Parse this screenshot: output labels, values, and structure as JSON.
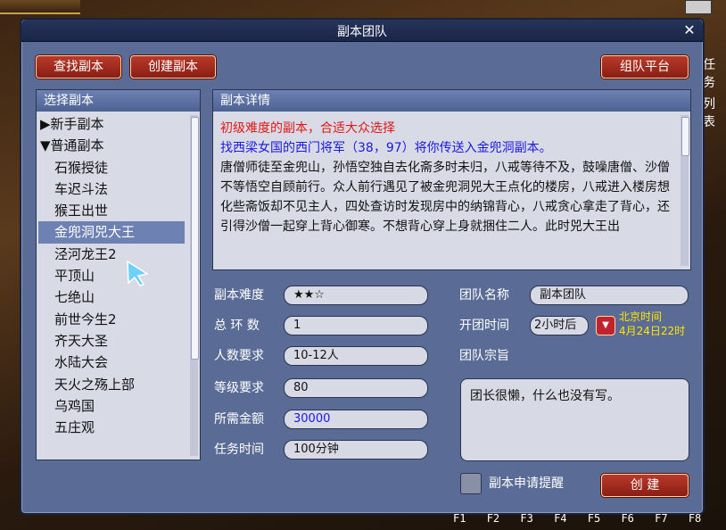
{
  "window": {
    "title": "副本团队"
  },
  "toolbar": {
    "find": "查找副本",
    "create": "创建副本",
    "platform": "组队平台"
  },
  "list": {
    "header": "选择副本",
    "items": [
      {
        "label": "▶新手副本"
      },
      {
        "label": "▼普通副本"
      },
      {
        "label": "石猴授徒"
      },
      {
        "label": "车迟斗法"
      },
      {
        "label": "猴王出世"
      },
      {
        "label": "金兜洞兕大王"
      },
      {
        "label": "泾河龙王2"
      },
      {
        "label": "平顶山"
      },
      {
        "label": "七绝山"
      },
      {
        "label": "前世今生2"
      },
      {
        "label": "齐天大圣"
      },
      {
        "label": "水陆大会"
      },
      {
        "label": "天火之殇上部"
      },
      {
        "label": "乌鸡国"
      },
      {
        "label": "五庄观"
      }
    ]
  },
  "detail": {
    "header": "副本详情",
    "difficulty_note": "初级难度的副本，合适大众选择",
    "teleport_note": "找西梁女国的西门将军（38，97）将你传送入金兜洞副本。",
    "story": "唐僧师徒至金兜山，孙悟空独自去化斋多时未归，八戒等待不及，鼓噪唐僧、沙僧不等悟空自顾前行。众人前行遇见了被金兜洞兕大王点化的楼房，八戒进入楼房想化些斋饭却不见主人，四处查访时发现房中的纳锦背心，八戒贪心拿走了背心，还引得沙僧一起穿上背心御寒。不想背心穿上身就捆住二人。此时兕大王出"
  },
  "form": {
    "difficulty_label": "副本难度",
    "difficulty_value": "★★☆",
    "rounds_label": "总 环 数",
    "rounds_value": "1",
    "people_label": "人数要求",
    "people_value": "10-12人",
    "level_label": "等级要求",
    "level_value": "80",
    "gold_label": "所需金额",
    "gold_value": "30000",
    "time_label": "任务时间",
    "time_value": "100分钟",
    "team_name_label": "团队名称",
    "team_name_value": "副本团队",
    "open_time_label": "开团时间",
    "open_time_value": "2小时后",
    "beijing_time": "北京时间",
    "date_time": "4月24日22时",
    "purpose_label": "团队宗旨",
    "purpose_value": "团长很懒，什么也没有写。",
    "reminder_label": "副本申请提醒",
    "create_button": "创 建"
  },
  "fkeys": [
    "F1",
    "F2",
    "F3",
    "F4",
    "F5",
    "F6",
    "F7",
    "F8"
  ],
  "side": {
    "task": "任务",
    "list": "列表"
  },
  "colors": {
    "accent_red": "#e01818",
    "link_blue": "#1a1ae0",
    "gold": "#ffe600"
  }
}
